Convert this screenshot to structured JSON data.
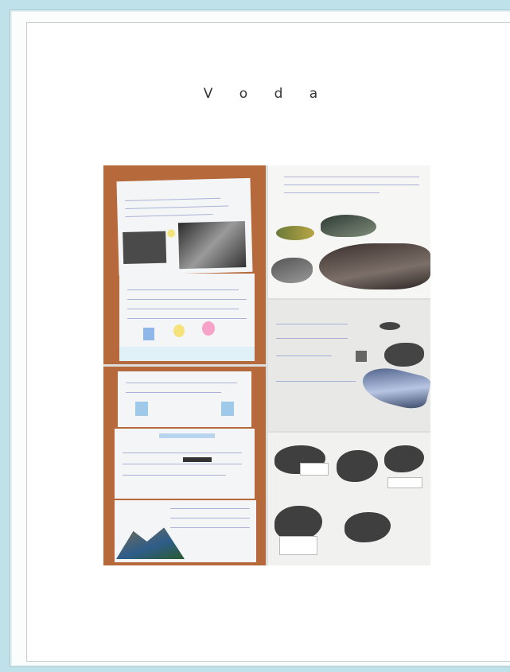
{
  "page": {
    "title": "V o d a"
  },
  "collage": {
    "photo_count": 6
  },
  "colors": {
    "background": "#bfe2ea",
    "page": "#ffffff",
    "wood": "#b66a3b"
  }
}
